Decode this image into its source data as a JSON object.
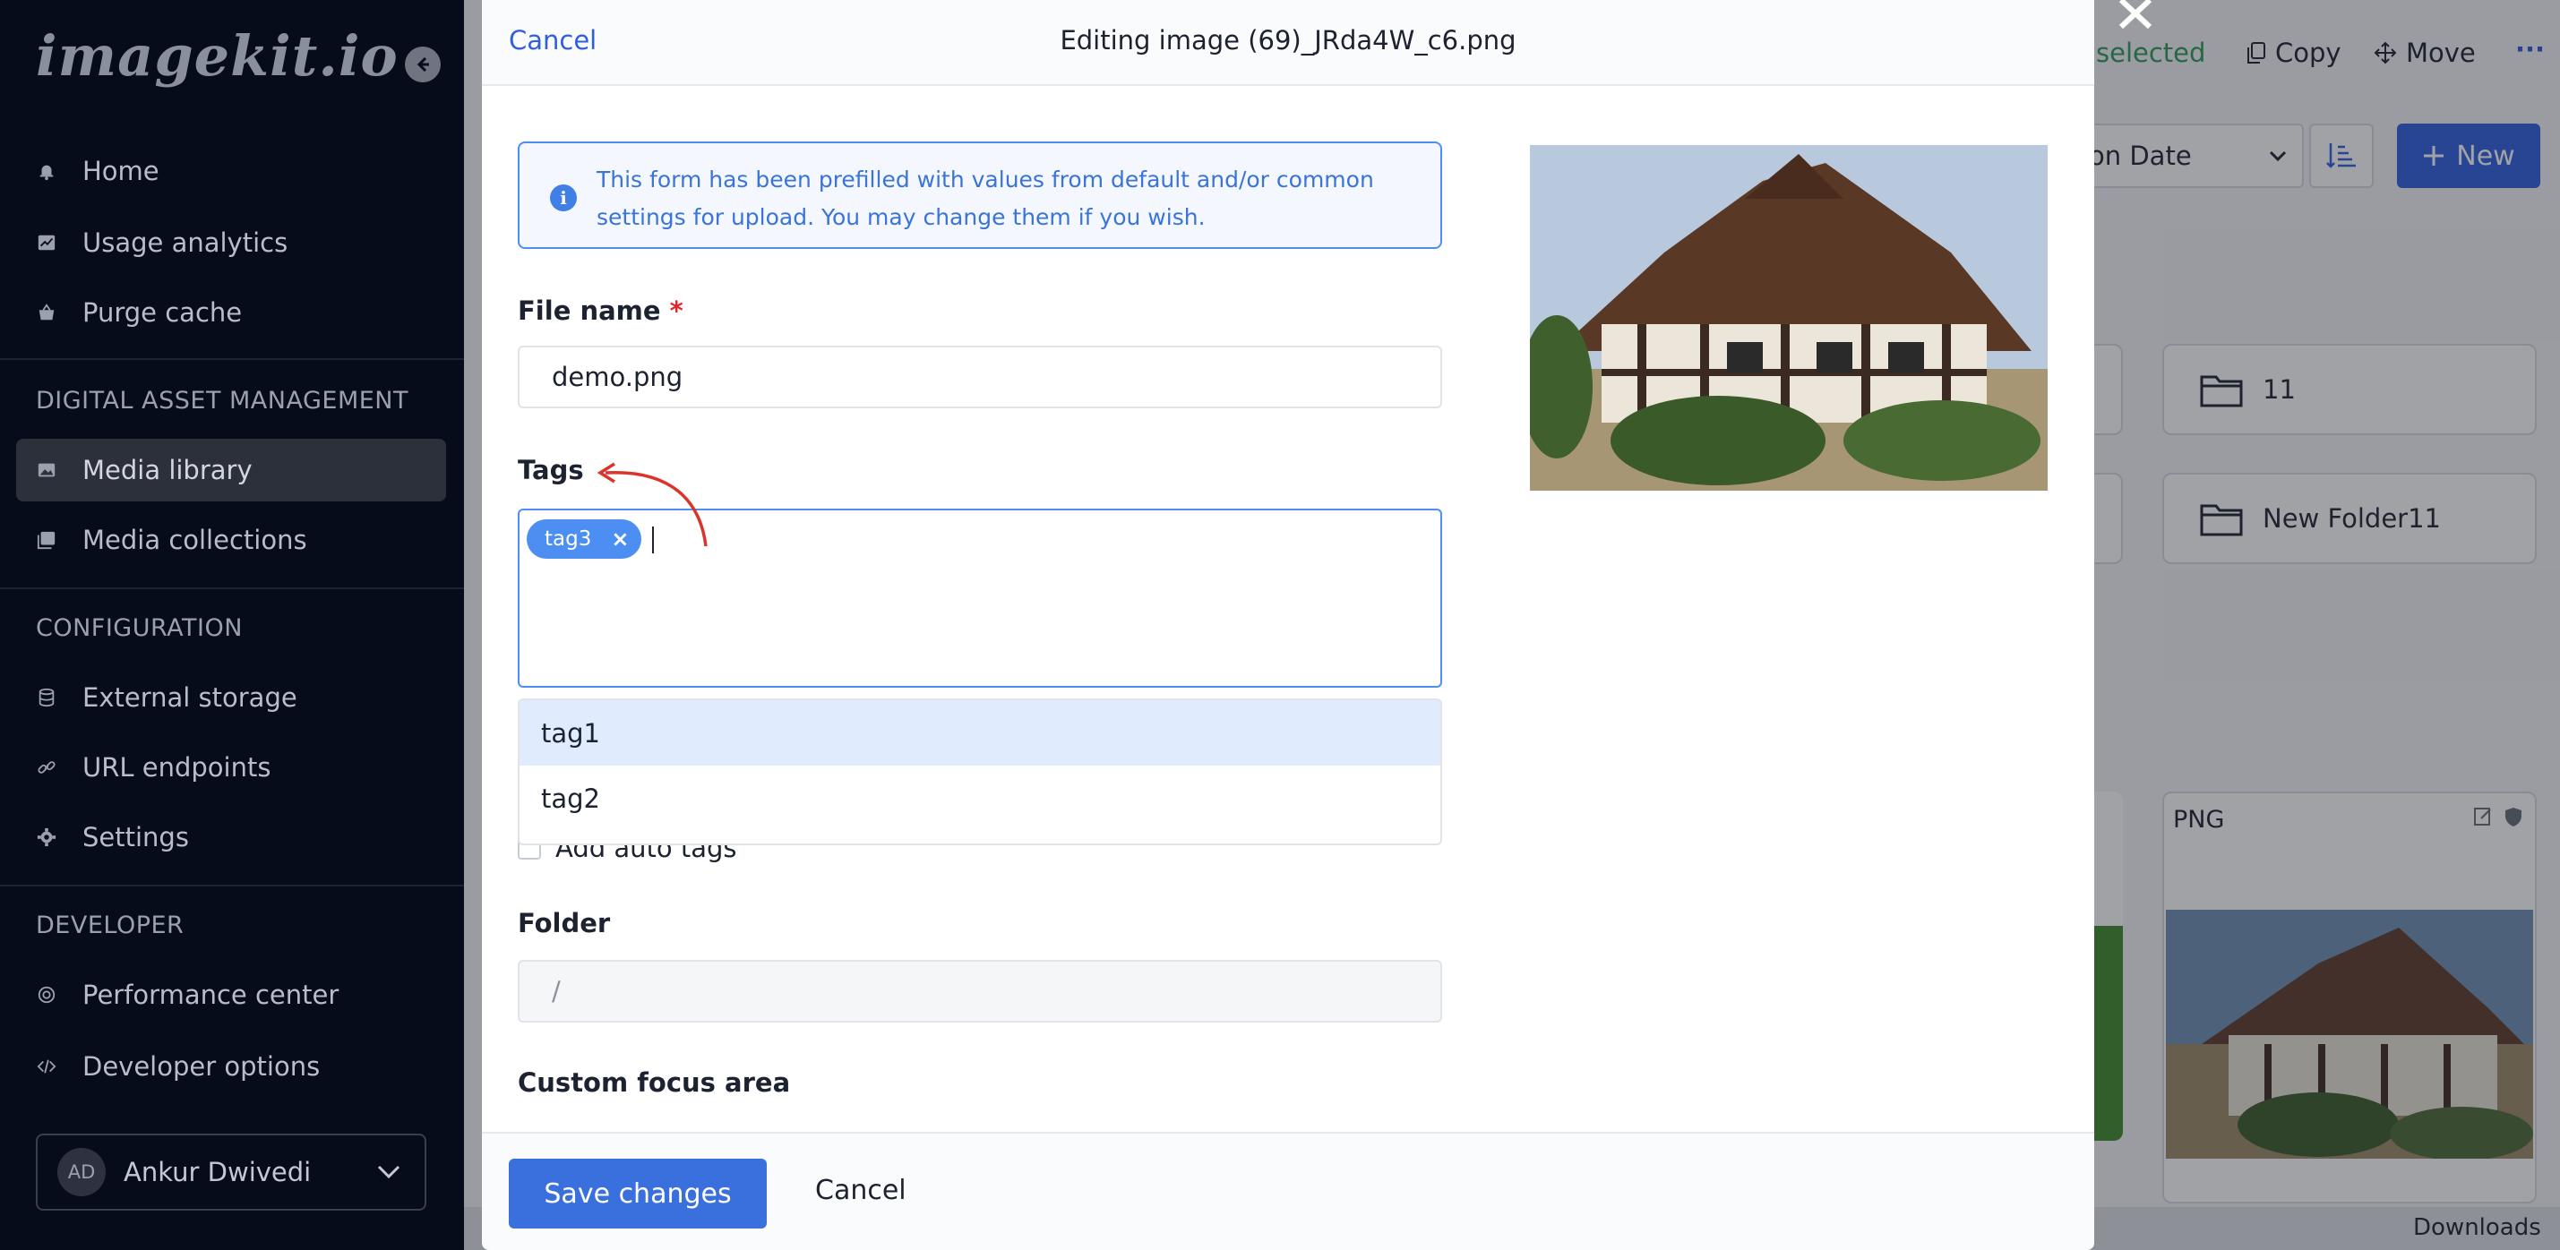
{
  "sidebar": {
    "logo": "imagekit.io",
    "items_top": [
      {
        "label": "Home",
        "icon": "bell-icon"
      },
      {
        "label": "Usage analytics",
        "icon": "chart-icon"
      },
      {
        "label": "Purge cache",
        "icon": "basket-icon"
      }
    ],
    "sections": [
      {
        "title": "DIGITAL ASSET MANAGEMENT",
        "items": [
          {
            "label": "Media library",
            "icon": "image-icon",
            "active": true
          },
          {
            "label": "Media collections",
            "icon": "collection-icon"
          }
        ]
      },
      {
        "title": "CONFIGURATION",
        "items": [
          {
            "label": "External storage",
            "icon": "database-icon"
          },
          {
            "label": "URL endpoints",
            "icon": "link-icon"
          },
          {
            "label": "Settings",
            "icon": "gear-icon"
          }
        ]
      },
      {
        "title": "DEVELOPER",
        "items": [
          {
            "label": "Performance center",
            "icon": "gauge-icon"
          },
          {
            "label": "Developer options",
            "icon": "code-icon"
          }
        ]
      }
    ],
    "user": {
      "initials": "AD",
      "name": "Ankur Dwivedi"
    }
  },
  "background": {
    "selected_text": "selected",
    "copy_label": "Copy",
    "move_label": "Move",
    "more_label": "···",
    "sort_label": "on Date",
    "new_label": "New",
    "folders": [
      {
        "name": "11"
      },
      {
        "name": "New Folder11"
      }
    ],
    "file_card": {
      "type": "PNG"
    },
    "downloads_label": "Downloads"
  },
  "modal": {
    "header_cancel": "Cancel",
    "title": "Editing image (69)_JRda4W_c6.png",
    "info_text": "This form has been prefilled with values from default and/or common settings for upload. You may change them if you wish.",
    "file_name_label": "File name",
    "required_mark": "*",
    "file_name_value": "demo.png",
    "tags_label": "Tags",
    "tags": [
      "tag3"
    ],
    "tag_remove": "×",
    "tag_suggestions": [
      "tag1",
      "tag2"
    ],
    "auto_tags_label": "Add auto tags",
    "folder_label": "Folder",
    "folder_value": "/",
    "focus_label": "Custom focus area",
    "save_label": "Save changes",
    "cancel_label": "Cancel"
  },
  "colors": {
    "sidebar_bg": "#070c1b",
    "accent_blue": "#3a6fde",
    "tag_blue": "#4d8ef2",
    "annotation_red": "#d9352c"
  }
}
